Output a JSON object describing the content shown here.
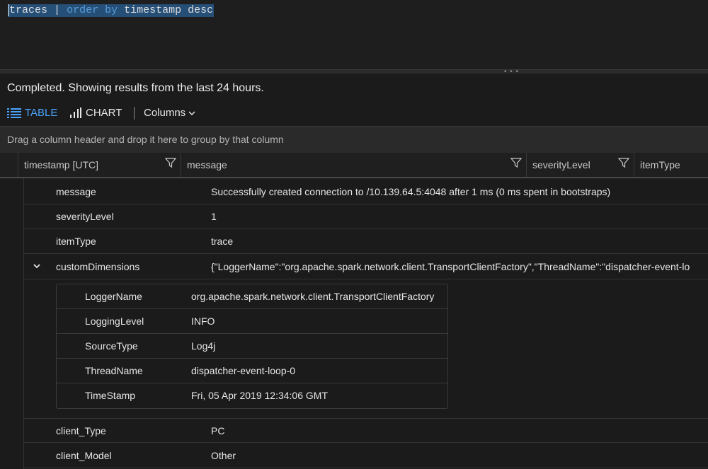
{
  "query": {
    "table": "traces",
    "pipe": "|",
    "keyword": "order by",
    "column": "timestamp",
    "direction": "desc"
  },
  "status_text": "Completed. Showing results from the last 24 hours.",
  "toolbar": {
    "table_label": "TABLE",
    "chart_label": "CHART",
    "columns_label": "Columns",
    "accent_color": "#4aa3ff"
  },
  "group_bar_text": "Drag a column header and drop it here to group by that column",
  "columns": [
    "timestamp [UTC]",
    "message",
    "severityLevel",
    "itemType"
  ],
  "detail": {
    "rows_top": [
      {
        "key": "message",
        "value": "Successfully created connection to /10.139.64.5:4048 after 1 ms (0 ms spent in bootstraps)"
      },
      {
        "key": "severityLevel",
        "value": "1"
      },
      {
        "key": "itemType",
        "value": "trace"
      }
    ],
    "custom_dimensions": {
      "key": "customDimensions",
      "value": "{\"LoggerName\":\"org.apache.spark.network.client.TransportClientFactory\",\"ThreadName\":\"dispatcher-event-lo",
      "nested": [
        {
          "key": "LoggerName",
          "value": "org.apache.spark.network.client.TransportClientFactory"
        },
        {
          "key": "LoggingLevel",
          "value": "INFO"
        },
        {
          "key": "SourceType",
          "value": "Log4j"
        },
        {
          "key": "ThreadName",
          "value": "dispatcher-event-loop-0"
        },
        {
          "key": "TimeStamp",
          "value": "Fri, 05 Apr 2019 12:34:06 GMT"
        }
      ]
    },
    "rows_bottom": [
      {
        "key": "client_Type",
        "value": "PC"
      },
      {
        "key": "client_Model",
        "value": "Other"
      }
    ]
  }
}
